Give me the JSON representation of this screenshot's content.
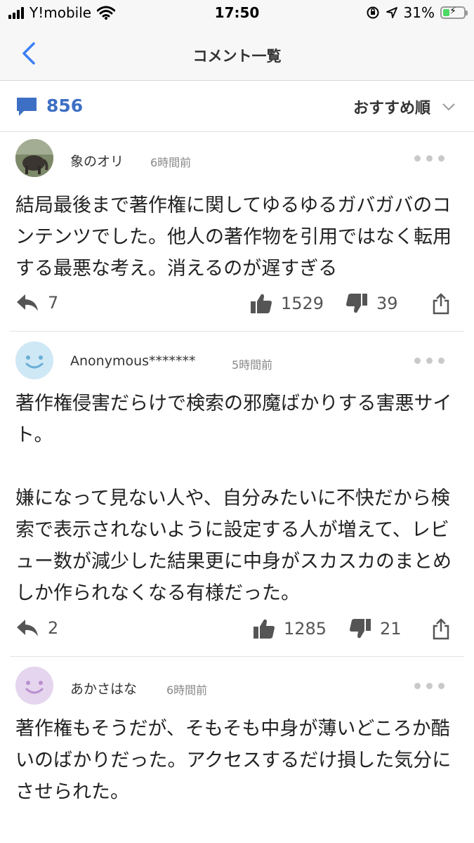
{
  "status_bar": {
    "carrier": "Y!mobile",
    "time": "17:50",
    "battery": "31%",
    "battery_level": 0.31
  },
  "nav": {
    "back_icon": "chevron-left-icon",
    "title": "コメント一覧"
  },
  "summary": {
    "comment_count": "856",
    "sort_label": "おすすめ順"
  },
  "comments": [
    {
      "username": "象のオリ",
      "time": "6時間前",
      "avatar": "photo",
      "body": "結局最後まで著作権に関してゆるゆるガバガバのコンテンツでした。他人の著作物を引用ではなく転用する最悪な考え。消えるのが遅すぎる",
      "replies": "7",
      "likes": "1529",
      "dislikes": "39"
    },
    {
      "username": "Anonymous*******",
      "time": "5時間前",
      "avatar": "blue-smiley",
      "body": "著作権侵害だらけで検索の邪魔ばかりする害悪サイト。\n\n嫌になって見ない人や、自分みたいに不快だから検索で表示されないように設定する人が増えて、レビュー数が減少した結果更に中身がスカスカのまとめしか作られなくなる有様だった。",
      "replies": "2",
      "likes": "1285",
      "dislikes": "21"
    },
    {
      "username": "あかさはな",
      "time": "6時間前",
      "avatar": "purple-smiley",
      "body": "著作権もそうだが、そもそも中身が薄いどころか酷いのばかりだった。アクセスするだけ損した気分にさせられた。"
    }
  ],
  "colors": {
    "accent": "#3d6fc4",
    "icon_gray": "#555555",
    "avatar_blue": "#cfe8f5",
    "avatar_purple": "#e5d5ee"
  }
}
